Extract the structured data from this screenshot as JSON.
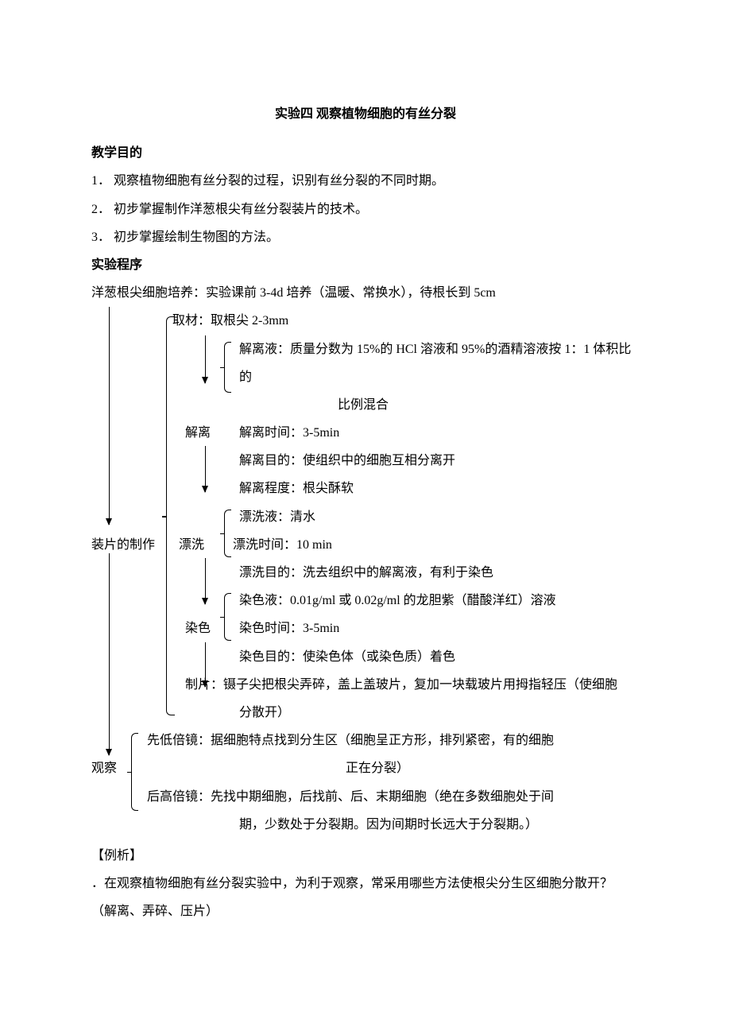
{
  "title": "实验四  观察植物细胞的有丝分裂",
  "sections": {
    "objectives_header": "教学目的",
    "objectives": [
      "1． 观察植物细胞有丝分裂的过程，识别有丝分裂的不同时期。",
      "2． 初步掌握制作洋葱根尖有丝分裂装片的技术。",
      "3． 初步掌握绘制生物图的方法。"
    ],
    "procedure_header": "实验程序",
    "culture": "洋葱根尖细胞培养：实验课前 3-4d 培养（温暖、常换水），待根长到 5cm",
    "sampling": "取材：取根尖 2-3mm",
    "slide_making_label": "装片的制作",
    "diss_label": "解离",
    "diss_sol_a": "解离液：质量分数为 15%的 HCl 溶液和 95%的酒精溶液按 1：1 体积比的",
    "diss_sol_b": "比例混合",
    "diss_time": "解离时间：3-5min",
    "diss_aim": "解离目的：使组织中的细胞互相分离开",
    "diss_deg": "解离程度：根尖酥软",
    "rinse_label": "漂洗",
    "rinse_sol": "漂洗液：清水",
    "rinse_time": "漂洗时间：10 min",
    "rinse_aim": "漂洗目的：洗去组织中的解离液，有利于染色",
    "stain_label": "染色",
    "stain_sol": "染色液：0.01g/ml 或 0.02g/ml 的龙胆紫（醋酸洋红）溶液",
    "stain_time": "染色时间：3-5min",
    "stain_aim": "染色目的：使染色体（或染色质）着色",
    "slide_a": "制片：镊子尖把根尖弄碎，盖上盖玻片，复加一块载玻片用拇指轻压（使细胞",
    "slide_b": "分散开）",
    "observe_label": "观察",
    "low_a": "先低倍镜：据细胞特点找到分生区（细胞呈正方形，排列紧密，有的细胞",
    "low_b": "正在分裂）",
    "high_a": "后高倍镜：先找中期细胞，后找前、后、末期细胞（绝在多数细胞处于间",
    "high_b": "期，少数处于分裂期。因为间期时长远大于分裂期。）",
    "example_header": "【例析】",
    "example_q": "．在观察植物细胞有丝分裂实验中，为利于观察，常采用哪些方法使根尖分生区细胞分散开？",
    "example_a": "（解离、弄碎、压片）"
  }
}
